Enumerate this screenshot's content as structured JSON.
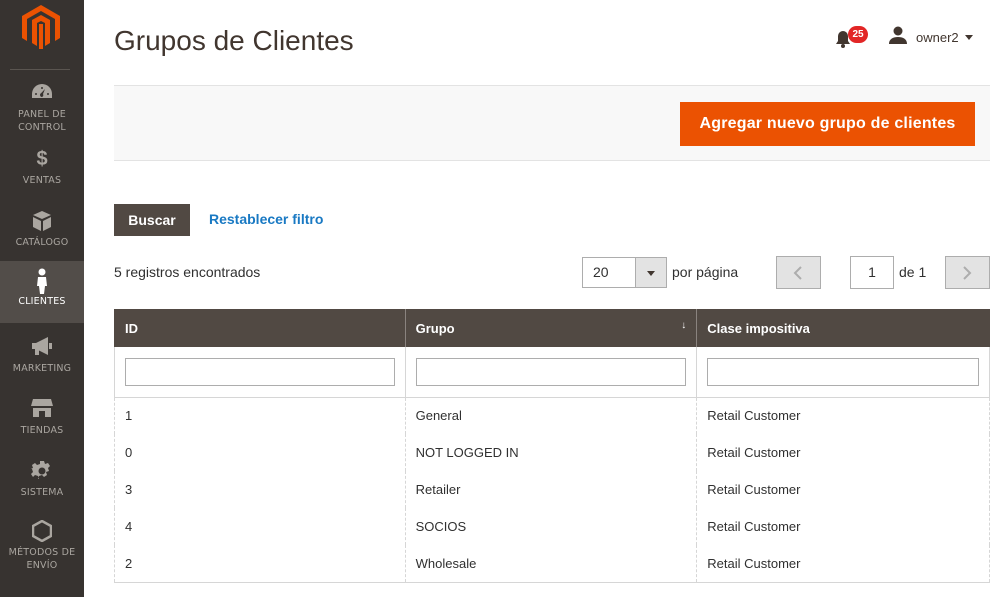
{
  "colors": {
    "accent": "#eb5202",
    "sidebar": "#373330",
    "header_dark": "#514943",
    "link": "#1979c3"
  },
  "sidebar": {
    "items": [
      {
        "label": "PANEL DE CONTROL",
        "icon": "dashboard-icon"
      },
      {
        "label": "VENTAS",
        "icon": "dollar-icon"
      },
      {
        "label": "CATÁLOGO",
        "icon": "box-icon"
      },
      {
        "label": "CLIENTES",
        "icon": "person-icon",
        "active": true
      },
      {
        "label": "MARKETING",
        "icon": "megaphone-icon"
      },
      {
        "label": "TIENDAS",
        "icon": "store-icon"
      },
      {
        "label": "SISTEMA",
        "icon": "gear-icon"
      },
      {
        "label": "MÉTODOS DE ENVÍO",
        "icon": "hexagon-icon"
      }
    ]
  },
  "header": {
    "title": "Grupos de Clientes",
    "notifications_count": "25",
    "user_name": "owner2"
  },
  "actions": {
    "add_label": "Agregar nuevo grupo de clientes"
  },
  "filters": {
    "search_label": "Buscar",
    "reset_label": "Restablecer filtro"
  },
  "pager": {
    "records_text": "5 registros encontrados",
    "per_page_value": "20",
    "per_page_label": "por página",
    "current_page": "1",
    "of_text": "de 1"
  },
  "table": {
    "columns": [
      "ID",
      "Grupo",
      "Clase impositiva"
    ],
    "sort_indicator": "↓",
    "rows": [
      [
        "1",
        "General",
        "Retail Customer"
      ],
      [
        "0",
        "NOT LOGGED IN",
        "Retail Customer"
      ],
      [
        "3",
        "Retailer",
        "Retail Customer"
      ],
      [
        "4",
        "SOCIOS",
        "Retail Customer"
      ],
      [
        "2",
        "Wholesale",
        "Retail Customer"
      ]
    ]
  }
}
